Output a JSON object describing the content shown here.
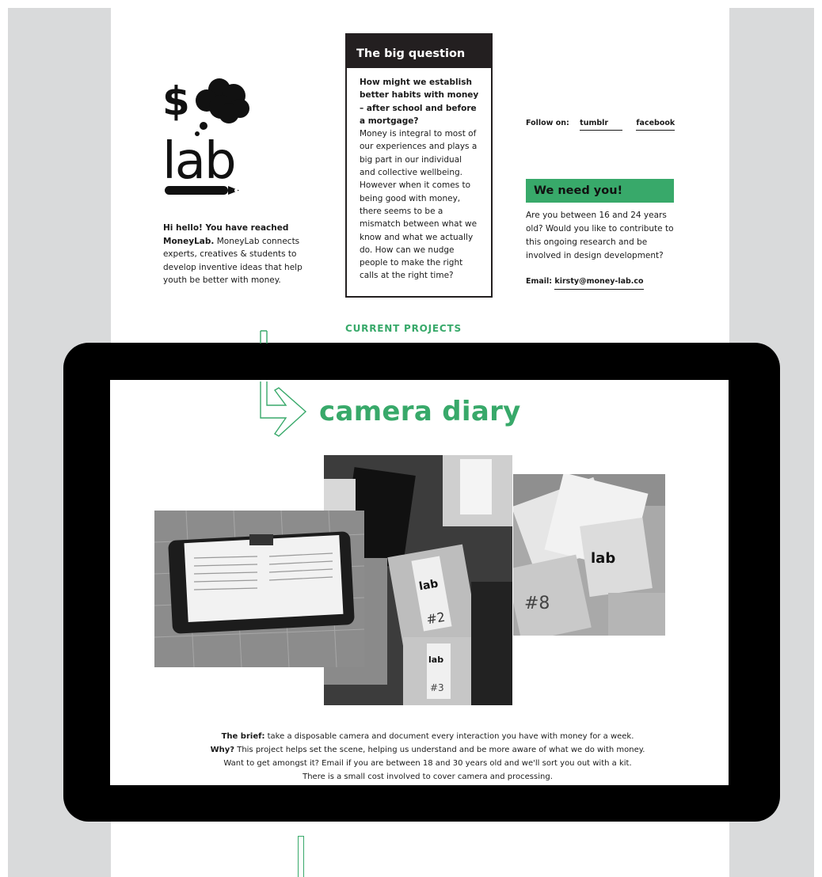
{
  "brand": {
    "logo_symbol": "$",
    "logo_word": "lab"
  },
  "intro": {
    "lead": "Hi hello! You have reached MoneyLab.",
    "text": " MoneyLab connects experts, creatives & students to develop inventive ideas that help youth be better with money."
  },
  "big_question": {
    "heading": "The big question",
    "question": "How might we establish better habits with money – after school and before a mortgage?",
    "body": "Money is integral to most of our experiences and plays a big part in our individual and collective wellbeing. However when it comes to being good with money, there seems to be a mismatch between what we know and what we actually do. How can we nudge people to make the right calls at the right time?"
  },
  "follow": {
    "label": "Follow on:",
    "links": [
      "tumblr",
      "facebook"
    ]
  },
  "need_you": {
    "heading": "We need you!",
    "text": "Are you between 16 and 24 years old? Would you like to contribute to this ongoing research and be involved in design development?",
    "email_label": "Email: ",
    "email": "kirsty@money-lab.co"
  },
  "projects": {
    "section_label": "CURRENT PROJECTS",
    "title": "camera diary",
    "brief_label": "The brief:",
    "brief": " take a disposable camera and document every interaction you have with money for a week.",
    "why_label": "Why?",
    "why": " This project helps set the scene, helping us understand and be more aware of what we do with money.",
    "line3": "Want to get amongst it? Email if you are between 18 and 30 years old and we'll sort you out with a kit.",
    "line4": "There is a small cost involved to cover camera and processing."
  },
  "photo_labels": {
    "lab_a": "lab",
    "lab_b": "lab",
    "lab_c": "lab",
    "tag_a": "#2",
    "tag_b": "#3",
    "tag_c": "#8"
  },
  "colors": {
    "accent": "#38a96a",
    "dark": "#231f20",
    "side_grey": "#d9dadb"
  }
}
